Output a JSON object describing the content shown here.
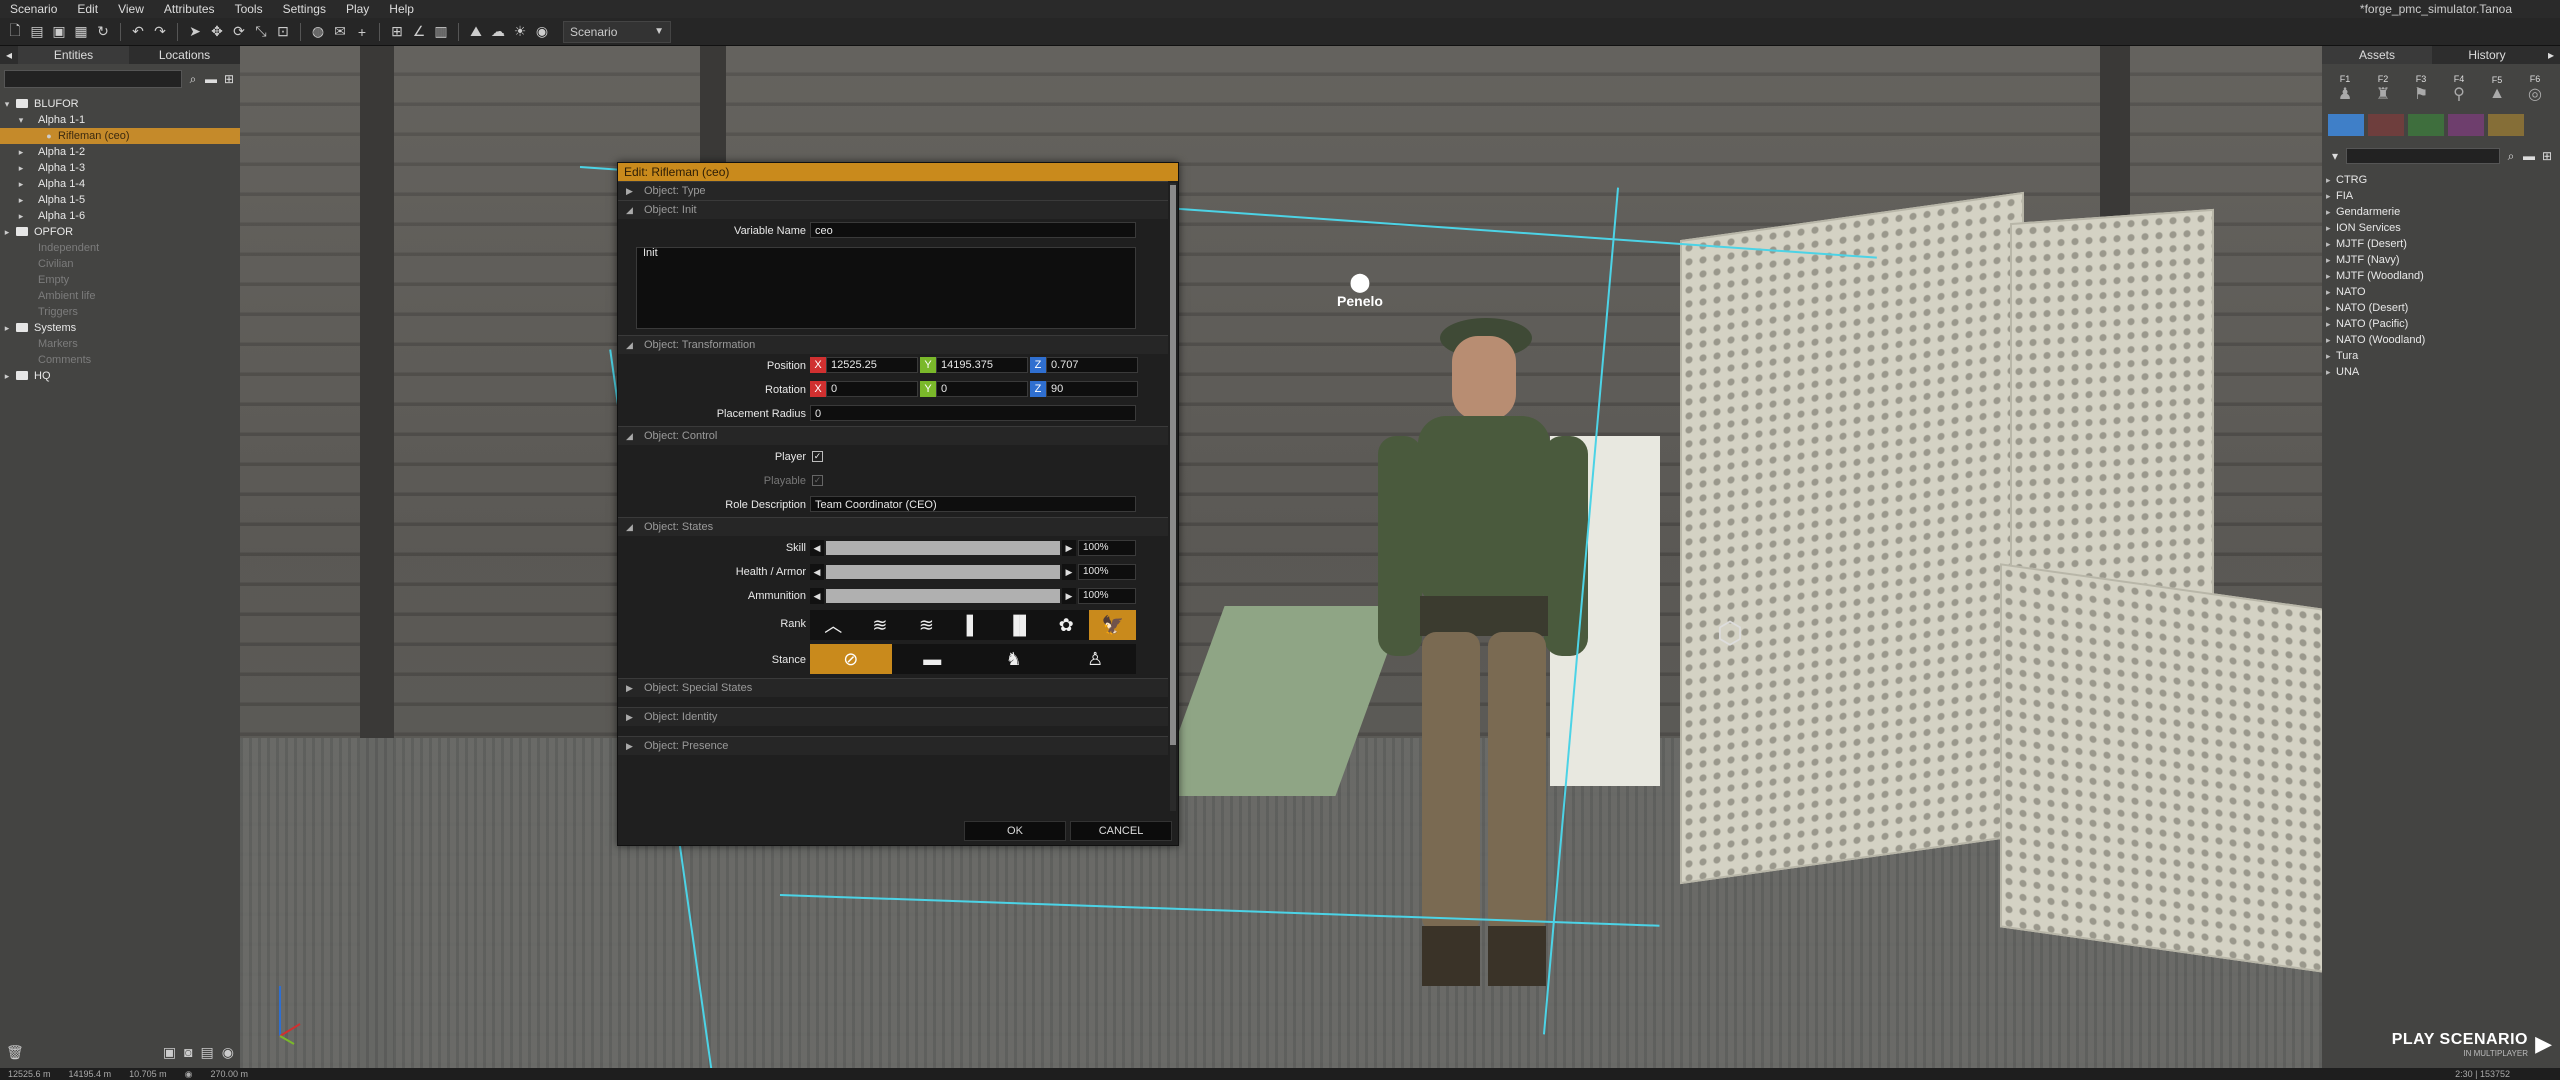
{
  "menu": [
    "Scenario",
    "Edit",
    "View",
    "Attributes",
    "Tools",
    "Settings",
    "Play",
    "Help"
  ],
  "document_title": "*forge_pmc_simulator.Tanoa",
  "toolbar": {
    "mode_combo": "Scenario"
  },
  "left_panel": {
    "tabs": [
      "Entities",
      "Locations"
    ],
    "tree": [
      {
        "label": "BLUFOR",
        "level": 0,
        "expand": "▾",
        "folder": true
      },
      {
        "label": "Alpha 1-1",
        "level": 1,
        "expand": "▾",
        "folder": false
      },
      {
        "label": "Rifleman (ceo)",
        "level": 2,
        "expand": "",
        "folder": false,
        "selected": true
      },
      {
        "label": "Alpha 1-2",
        "level": 1,
        "expand": "▸",
        "folder": false
      },
      {
        "label": "Alpha 1-3",
        "level": 1,
        "expand": "▸",
        "folder": false
      },
      {
        "label": "Alpha 1-4",
        "level": 1,
        "expand": "▸",
        "folder": false
      },
      {
        "label": "Alpha 1-5",
        "level": 1,
        "expand": "▸",
        "folder": false
      },
      {
        "label": "Alpha 1-6",
        "level": 1,
        "expand": "▸",
        "folder": false
      },
      {
        "label": "OPFOR",
        "level": 0,
        "expand": "▸",
        "folder": true
      },
      {
        "label": "Independent",
        "level": 1,
        "expand": "",
        "folder": false,
        "faded": true
      },
      {
        "label": "Civilian",
        "level": 1,
        "expand": "",
        "folder": false,
        "faded": true
      },
      {
        "label": "Empty",
        "level": 1,
        "expand": "",
        "folder": false,
        "faded": true
      },
      {
        "label": "Ambient life",
        "level": 1,
        "expand": "",
        "folder": false,
        "faded": true
      },
      {
        "label": "Triggers",
        "level": 1,
        "expand": "",
        "folder": false,
        "faded": true
      },
      {
        "label": "Systems",
        "level": 0,
        "expand": "▸",
        "folder": true
      },
      {
        "label": "Markers",
        "level": 1,
        "expand": "",
        "folder": false,
        "faded": true
      },
      {
        "label": "Comments",
        "level": 1,
        "expand": "",
        "folder": false,
        "faded": true
      },
      {
        "label": "HQ",
        "level": 0,
        "expand": "▸",
        "folder": true
      }
    ]
  },
  "right_panel": {
    "tabs": [
      "Assets",
      "History"
    ],
    "side_tabs": [
      "F1",
      "F2",
      "F3",
      "F4",
      "F5",
      "F6"
    ],
    "factions": [
      "CTRG",
      "FIA",
      "Gendarmerie",
      "ION Services",
      "MJTF (Desert)",
      "MJTF (Navy)",
      "MJTF (Woodland)",
      "NATO",
      "NATO (Desert)",
      "NATO (Pacific)",
      "NATO (Woodland)",
      "Tura",
      "UNA"
    ],
    "play_label": "PLAY SCENARIO",
    "play_sub": "IN MULTIPLAYER"
  },
  "scene": {
    "marker_label": "Penelo"
  },
  "status": {
    "x": "12525.6 m",
    "y": "14195.4 m",
    "alt": "10.705 m",
    "height": "270.00 m",
    "time": "2:30 | 153752"
  },
  "dialog": {
    "title": "Edit: Rifleman (ceo)",
    "sections": {
      "type": "Object: Type",
      "init": "Object: Init",
      "transformation": "Object: Transformation",
      "control": "Object: Control",
      "states": "Object: States",
      "special": "Object: Special States",
      "identity": "Object: Identity",
      "presence": "Object: Presence"
    },
    "variable_name_label": "Variable Name",
    "variable_name": "ceo",
    "init_label": "Init",
    "position_label": "Position",
    "position": {
      "x": "12525.25",
      "y": "14195.375",
      "z": "0.707"
    },
    "rotation_label": "Rotation",
    "rotation": {
      "x": "0",
      "y": "0",
      "z": "90"
    },
    "placement_radius_label": "Placement Radius",
    "placement_radius": "0",
    "player_label": "Player",
    "playable_label": "Playable",
    "role_label": "Role Description",
    "role": "Team Coordinator (CEO)",
    "skill_label": "Skill",
    "skill": "100%",
    "health_label": "Health / Armor",
    "health": "100%",
    "ammo_label": "Ammunition",
    "ammo": "100%",
    "rank_label": "Rank",
    "stance_label": "Stance",
    "ok": "OK",
    "cancel": "CANCEL"
  },
  "colors": {
    "accent": "#c98a1c",
    "x_axis": "#d03030",
    "y_axis": "#7ab82a",
    "z_axis": "#2f6fd0"
  }
}
